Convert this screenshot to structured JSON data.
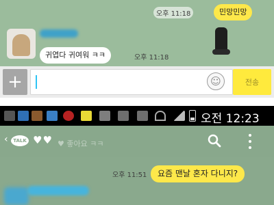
{
  "top_chat": {
    "my_message": {
      "text": "민망민망",
      "time": "오후 11:18"
    },
    "friend_message": {
      "text": "귀엽다 귀여워 ㅋㅋ",
      "time": "오후 11:18"
    }
  },
  "input_bar": {
    "placeholder": "",
    "send_label": "전송"
  },
  "status_bar": {
    "time": "오전 12:23"
  },
  "bottom_chat": {
    "header_ghost_text": "♥ 좋아요 ㅋㅋ",
    "my_message": {
      "text": "요즘 맨날 혼자 다니지?",
      "time": "오후 11:51"
    }
  },
  "colors": {
    "chat_bg": "#9bbc9c",
    "my_bubble": "#fde84a",
    "friend_bubble": "#ffffff",
    "send_button": "#ffea3d",
    "caret": "#2ec4f4"
  },
  "icons": [
    "plus-icon",
    "emoji-icon",
    "back-arrow-icon",
    "talk-icon",
    "heart-icon",
    "search-icon",
    "more-icon",
    "battery-icon"
  ]
}
